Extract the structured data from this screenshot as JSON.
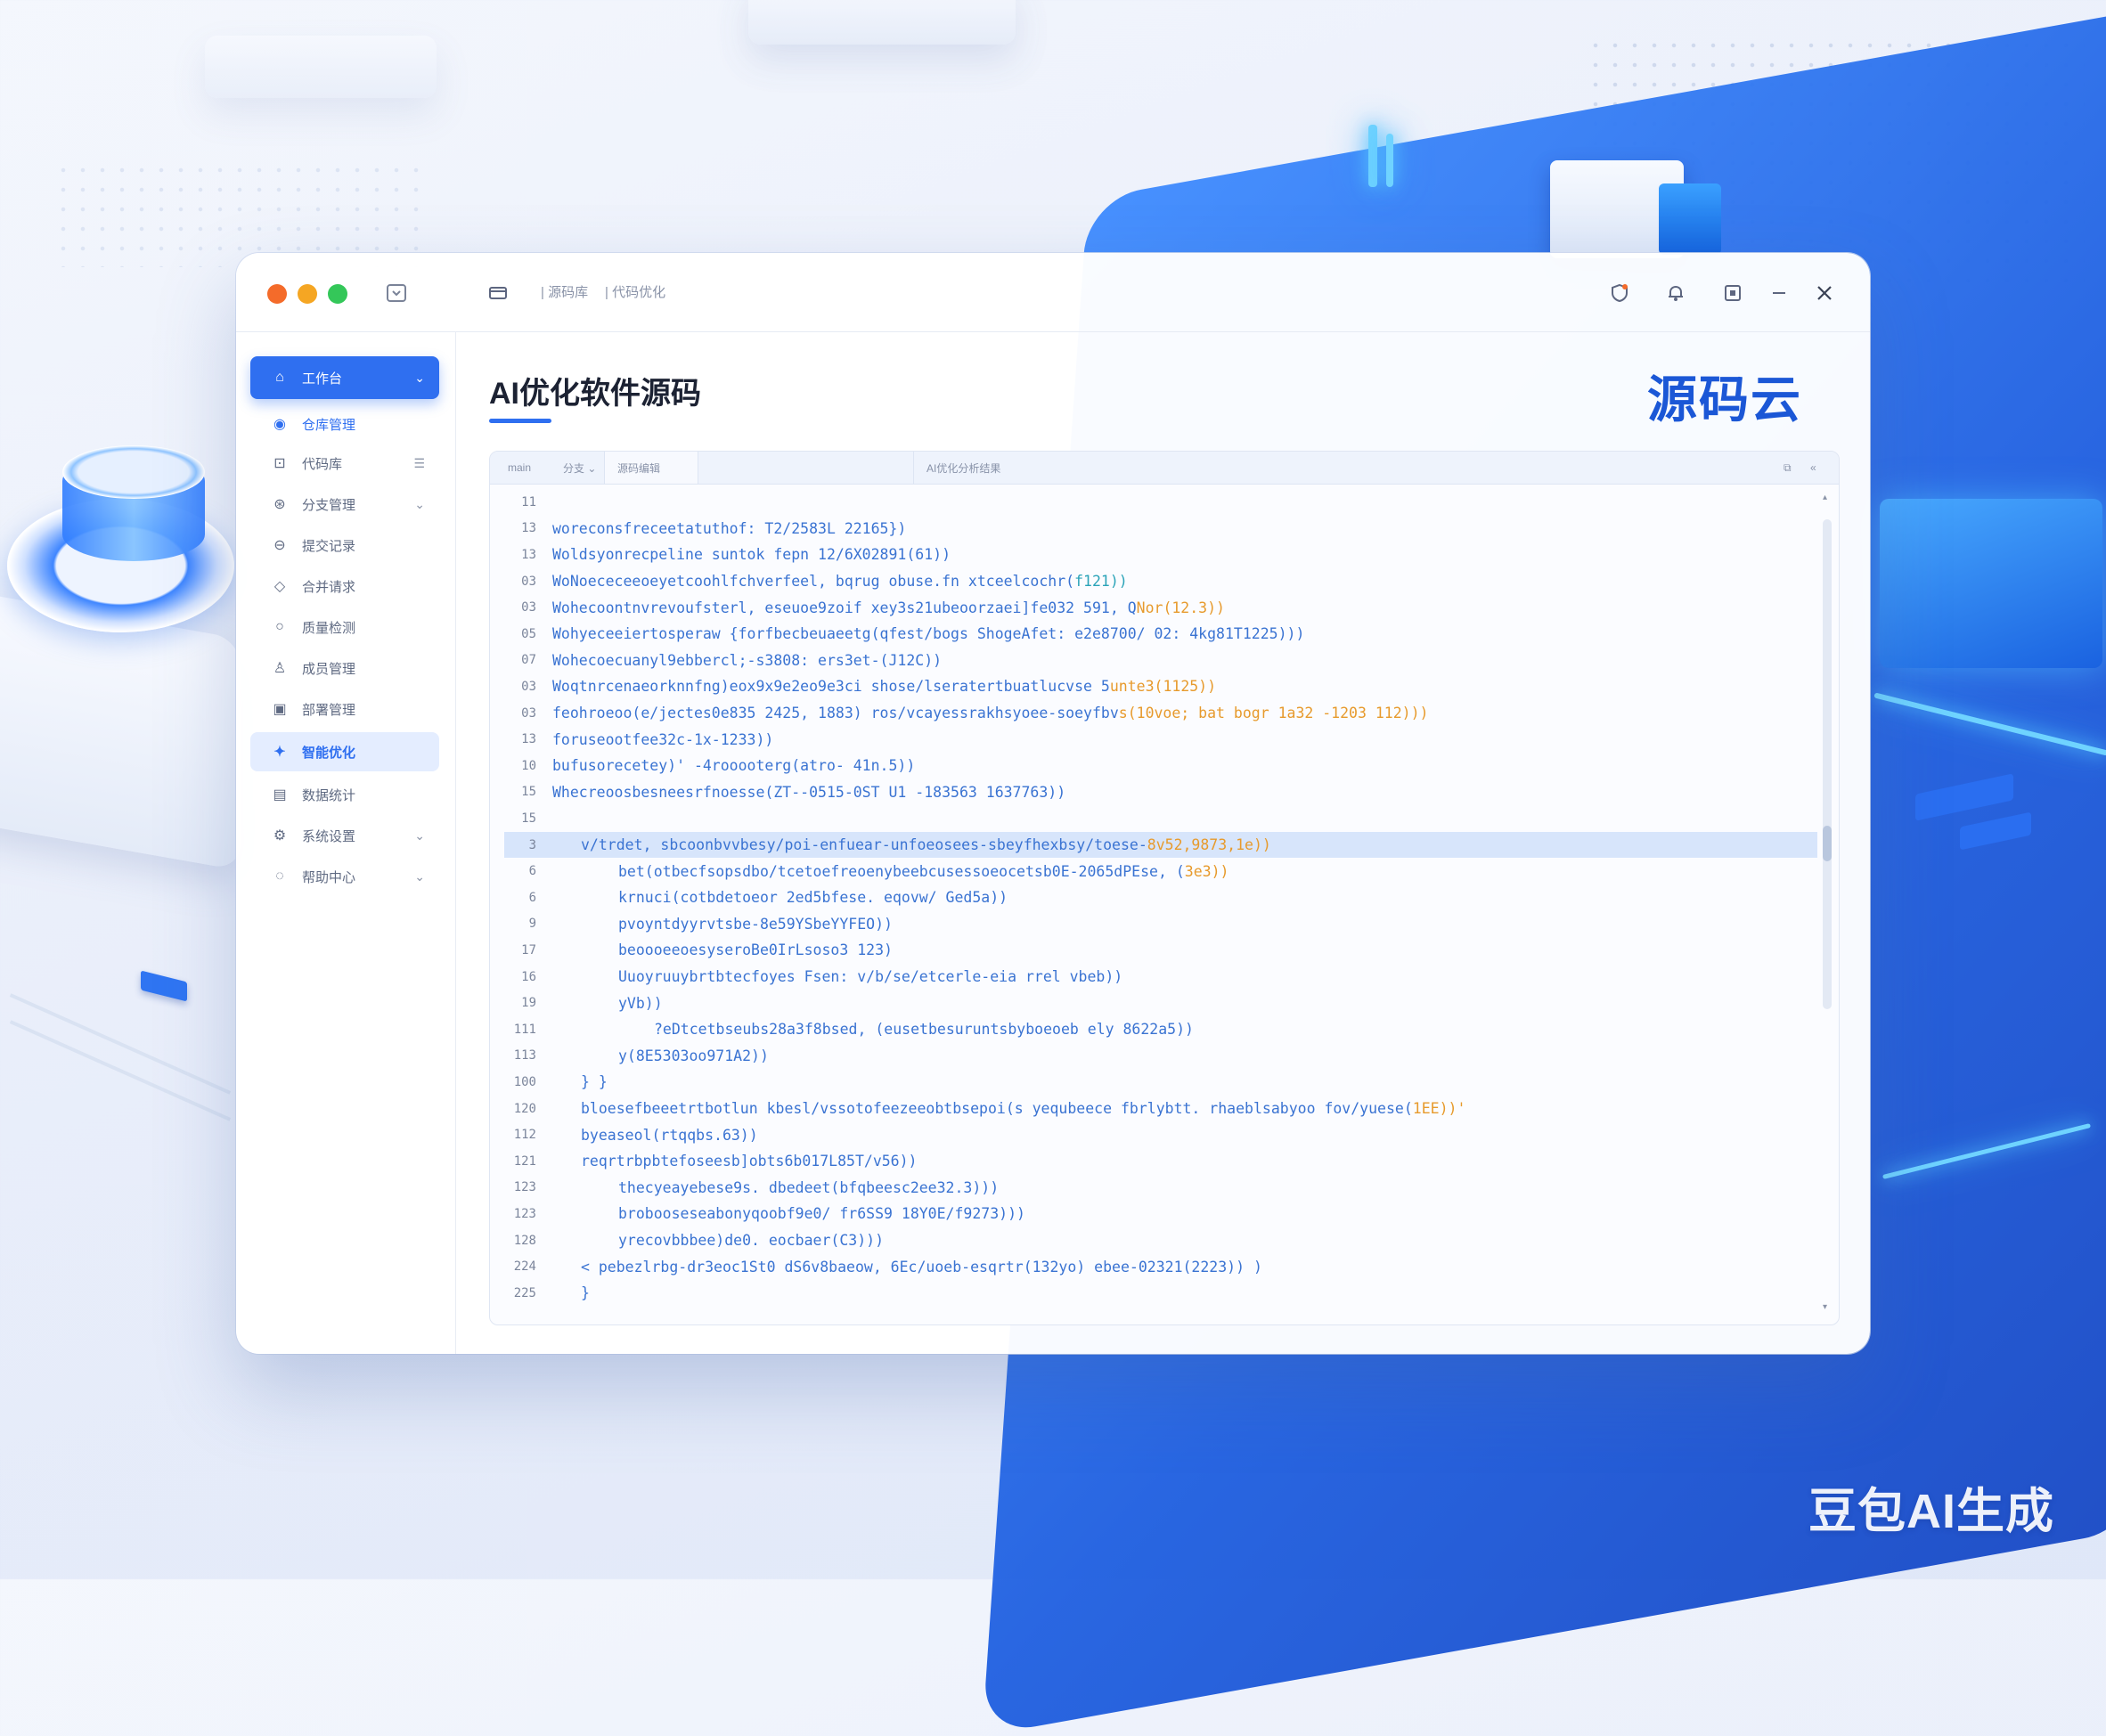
{
  "window": {
    "traffic_lights": [
      "#f46b2a",
      "#f5a623",
      "#34c759"
    ],
    "breadcrumb_1": "| 源码库",
    "breadcrumb_2": "| 代码优化",
    "title_icons": [
      "shield-icon",
      "bell-icon",
      "maximize-icon",
      "minimize-icon",
      "close-icon"
    ]
  },
  "sidebar": {
    "items": [
      {
        "label": "工作台",
        "icon": "home-icon",
        "state": "primary",
        "tail": "⌄"
      },
      {
        "label": "仓库管理",
        "icon": "repo-icon",
        "state": "sub",
        "tail": ""
      },
      {
        "label": "代码库",
        "icon": "code-icon",
        "state": "normal",
        "tail": "☰"
      },
      {
        "label": "分支管理",
        "icon": "branch-icon",
        "state": "normal",
        "tail": "⌄"
      },
      {
        "label": "提交记录",
        "icon": "commit-icon",
        "state": "normal",
        "tail": ""
      },
      {
        "label": "合并请求",
        "icon": "merge-icon",
        "state": "normal",
        "tail": ""
      },
      {
        "label": "质量检测",
        "icon": "check-icon",
        "state": "normal",
        "tail": ""
      },
      {
        "label": "成员管理",
        "icon": "user-icon",
        "state": "normal",
        "tail": ""
      },
      {
        "label": "部署管理",
        "icon": "deploy-icon",
        "state": "normal",
        "tail": ""
      },
      {
        "label": "智能优化",
        "icon": "ai-icon",
        "state": "active",
        "tail": ""
      },
      {
        "label": "数据统计",
        "icon": "chart-icon",
        "state": "normal",
        "tail": ""
      },
      {
        "label": "系统设置",
        "icon": "settings-icon",
        "state": "normal",
        "tail": "⌄"
      },
      {
        "label": "帮助中心",
        "icon": "help-icon",
        "state": "normal",
        "tail": "⌄"
      }
    ]
  },
  "main": {
    "title": "AI优化软件源码",
    "brand": "源码云"
  },
  "editor": {
    "tabs": [
      "main",
      "分支 ⌄",
      "源码编辑",
      "AI优化分析结果"
    ],
    "lines": [
      {
        "n": "11",
        "indent": 0,
        "code": "",
        "tail": ""
      },
      {
        "n": "13",
        "indent": 0,
        "code": "woreconsfreceetatuthof: T2/2583L 22165})",
        "tail": ""
      },
      {
        "n": "13",
        "indent": 0,
        "code": "Woldsyonrecpeline suntok fepn 12/6X02891(61))",
        "tail": ""
      },
      {
        "n": "03",
        "indent": 0,
        "code": "WoNoececeeoeyetcoohlfchverfeel, bqrug obuse.fn xtceelcochr(",
        "tail": "f121))"
      },
      {
        "n": "03",
        "indent": 0,
        "code": "Wohecoontnvrevoufsterl, eseuoe9zoif xey3s21ubeoorzaei]fe032 591, Q",
        "tail": "Nor(12.3))"
      },
      {
        "n": "05",
        "indent": 0,
        "code": "Wohyeceeiertosperaw {forfbecbeuaeetg(qfest/bogs ShogeAfet: e2e8700/ 02: 4kg81T1225)))",
        "tail": ""
      },
      {
        "n": "07",
        "indent": 0,
        "code": "Wohecoecuanyl9ebbercl;-s3808: ers3et-(J12C))",
        "tail": ""
      },
      {
        "n": "03",
        "indent": 0,
        "code": "Woqtnrcenaeorknnfng)eox9x9e2eo9e3ci shose/lseratertbuatlucvse 5",
        "tail": "unte3(1125))"
      },
      {
        "n": "03",
        "indent": 0,
        "code": "feohroeoo(e/jectes0e835 2425, 1883) ros/vcayessrakhsyoee-soeyfbv",
        "tail": "s(10voe; bat bogr 1a32 -1203 112)))"
      },
      {
        "n": "13",
        "indent": 0,
        "code": "foruseootfee32c-1x-1233))",
        "tail": ""
      },
      {
        "n": "10",
        "indent": 0,
        "code": "bufusorecetey)' -4rooooterg(atro- 41n.5))",
        "tail": ""
      },
      {
        "n": "15",
        "indent": 0,
        "code": "Whecreoosbesneesrfnoesse(ZT--0515-0ST U1 -183563 1637763))",
        "tail": ""
      },
      {
        "n": "15",
        "indent": 0,
        "code": "",
        "tail": ""
      },
      {
        "n": "3",
        "indent": 1,
        "code": "v/trdet, sbcoonbvvbesy/poi-enfuear-unfoeosees-sbeyfhexbsy/toese-",
        "tail": "8v52,9873,1e))",
        "hl": true
      },
      {
        "n": "6",
        "indent": 2,
        "code": "bet(otbecfsopsdbo/tcetoefreoenybeebcusessoeocetsb0E-2065dPEse, (",
        "tail": "3e3))"
      },
      {
        "n": "6",
        "indent": 2,
        "code": "krnuci(cotbdetoeor 2ed5bfese. eqovw/ Ged5a))",
        "tail": ""
      },
      {
        "n": "9",
        "indent": 2,
        "code": "pvoyntdyyrvtsbe-8e59YSbeYYFEO))",
        "tail": ""
      },
      {
        "n": "17",
        "indent": 2,
        "code": "beoooeeoesyseroBe0IrLsoso3 123)",
        "tail": ""
      },
      {
        "n": "16",
        "indent": 2,
        "code": "Uuoyruuybrtbtecfoyes Fsen: v/b/se/etcerle-eia rrel vbeb))",
        "tail": ""
      },
      {
        "n": "19",
        "indent": 2,
        "code": "yVb))",
        "tail": ""
      },
      {
        "n": "111",
        "indent": 3,
        "code": "?eDtcetbseubs28a3f8bsed, (eusetbesuruntsbyboeoeb ely 8622a5))",
        "tail": ""
      },
      {
        "n": "113",
        "indent": 2,
        "code": "y(8E5303oo971A2))",
        "tail": ""
      },
      {
        "n": "100",
        "indent": 1,
        "code": "} }",
        "tail": ""
      },
      {
        "n": "120",
        "indent": 1,
        "code": "bloesefbeeetrtbotlun kbesl/vssotofeezeeobtbsepoi(s yequbeece fbrlybtt. rhaeblsabyoo fov/yuese(",
        "tail": "1EE))'"
      },
      {
        "n": "112",
        "indent": 1,
        "code": "byeaseol(rtqqbs.63))",
        "tail": ""
      },
      {
        "n": "121",
        "indent": 1,
        "code": "reqrtrbpbtefoseesb]obts6b017L85T/v56))",
        "tail": ""
      },
      {
        "n": "123",
        "indent": 2,
        "code": "thecyeayebese9s. dbedeet(bfqbeesc2ee32.3)))",
        "tail": ""
      },
      {
        "n": "123",
        "indent": 2,
        "code": "brobooseseabonyqoobf9e0/ fr6SS9 18Y0E/f9273)))",
        "tail": ""
      },
      {
        "n": "128",
        "indent": 2,
        "code": "yrecovbbbee)de0. eocbaer(C3)))",
        "tail": ""
      },
      {
        "n": "224",
        "indent": 1,
        "code": "< pebezlrbg-dr3eoc1St0 dS6v8baeow, 6Ec/uoeb-esqrtr(132yo) ebee-02321(2223)) )",
        "tail": ""
      },
      {
        "n": "225",
        "indent": 1,
        "code": "}",
        "tail": ""
      }
    ]
  },
  "watermark": "豆包AI生成"
}
